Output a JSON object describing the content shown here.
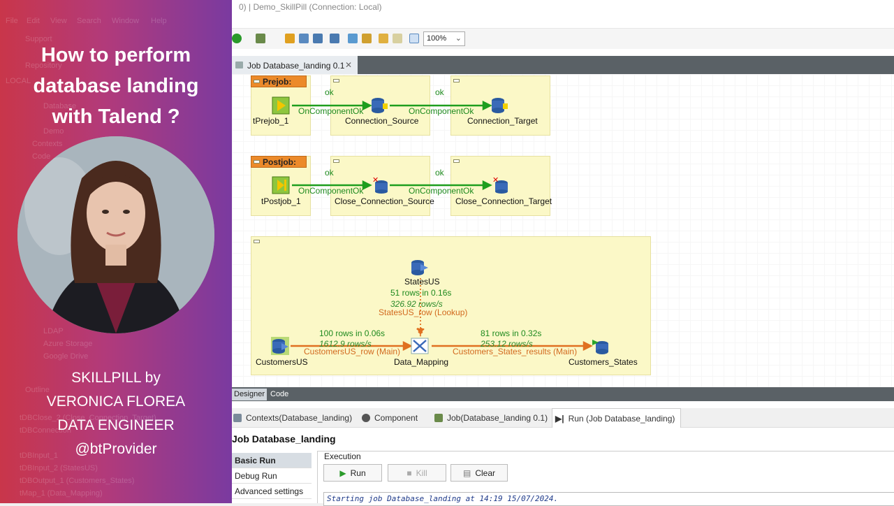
{
  "promo": {
    "title_lines": [
      "How to perform",
      "database landing",
      "with Talend ?"
    ],
    "credit_lines": [
      "SKILLPILL by",
      "VERONICA FLOREA",
      "DATA ENGINEER",
      "@btProvider"
    ],
    "ghost": [
      "File",
      "Edit",
      "View",
      "Search",
      "Window",
      "Help",
      "Support",
      "Repository",
      "LOCAL",
      "Database",
      "Demo",
      "Contexts",
      "Code",
      "LDAP",
      "Azure Storage",
      "Google Drive",
      "Outline",
      "tDBClose_2 (Close_Connection_Target)",
      "tDBConnection",
      "tDBInput_1",
      "tDBInput_2 (StatesUS)",
      "tDBOutput_1 (Customers_States)",
      "tMap_1 (Data_Mapping)"
    ]
  },
  "titlebar": {
    "text": "0) | Demo_SkillPill (Connection: Local)"
  },
  "toolbar": {
    "zoom": "100%"
  },
  "editor_tab": {
    "label": "Job Database_landing 0.1",
    "close": "✕"
  },
  "canvas": {
    "prejob": {
      "header": "Prejob:",
      "start": "tPrejob_1",
      "c1": "Connection_Source",
      "c2": "Connection_Target",
      "trigger": "OnComponentOk",
      "ok": "ok"
    },
    "postjob": {
      "header": "Postjob:",
      "start": "tPostjob_1",
      "c1": "Close_Connection_Source",
      "c2": "Close_Connection_Target",
      "trigger": "OnComponentOk",
      "ok": "ok"
    },
    "main": {
      "lookup": {
        "name": "StatesUS",
        "rows": "51 rows in 0.16s",
        "rate": "326.92 rows/s",
        "link": "StatesUS_row (Lookup)"
      },
      "input": {
        "name": "CustomersUS",
        "rows": "100 rows in 0.06s",
        "rate": "1612.9 rows/s",
        "link": "CustomersUS_row (Main)"
      },
      "map": {
        "name": "Data_Mapping"
      },
      "output": {
        "name": "Customers_States",
        "rows": "81 rows in 0.32s",
        "rate": "253.12 rows/s",
        "link": "Customers_States_results (Main)"
      }
    }
  },
  "bottom_tabs": {
    "designer": "Designer",
    "code": "Code"
  },
  "views": [
    "Contexts(Database_landing)",
    "Component",
    "Job(Database_landing 0.1)",
    "Run (Job Database_landing)"
  ],
  "run": {
    "title": "Job Database_landing",
    "side": [
      "Basic Run",
      "Debug Run",
      "Advanced settings"
    ],
    "execution": "Execution",
    "run_btn": "Run",
    "kill_btn": "Kill",
    "clear_btn": "Clear",
    "console": "Starting job Database_landing at 14:19 15/07/2024."
  },
  "colors": {
    "subjob_fill": "#fbf8c7",
    "trigger_line": "#1e9e1e",
    "main_line": "#e07020",
    "header": "#ec8a2a"
  }
}
